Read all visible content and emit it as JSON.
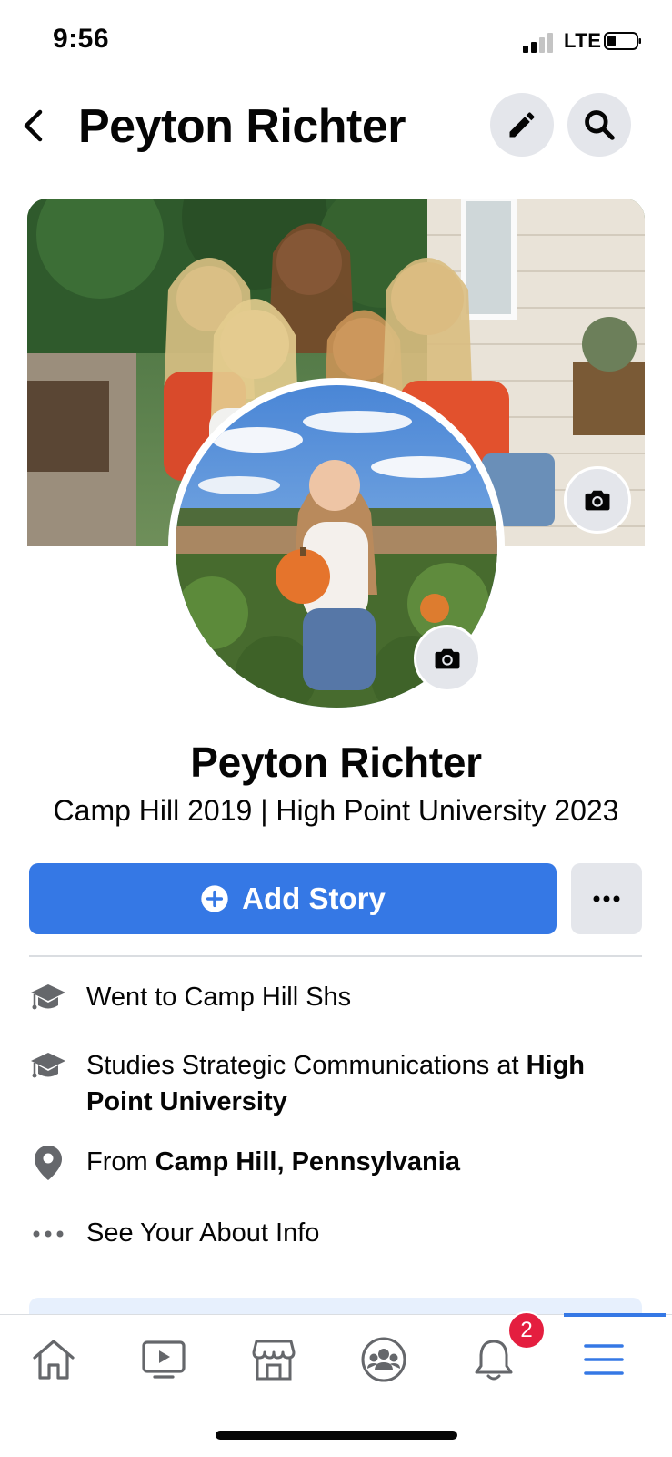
{
  "status": {
    "time": "9:56",
    "network": "LTE"
  },
  "header": {
    "title": "Peyton Richter"
  },
  "profile": {
    "name": "Peyton Richter",
    "bio": "Camp Hill 2019 | High Point University 2023",
    "add_story_label": "Add Story"
  },
  "about": [
    {
      "icon": "graduation-cap-icon",
      "text": "Went to Camp Hill Shs"
    },
    {
      "icon": "graduation-cap-icon",
      "prefix": "Studies Strategic Communications at ",
      "bold": "High Point University"
    },
    {
      "icon": "location-pin-icon",
      "prefix": "From ",
      "bold": "Camp Hill, Pennsylvania"
    },
    {
      "icon": "more-dots-icon",
      "text": "See Your About Info"
    }
  ],
  "tabs": [
    {
      "name": "home",
      "icon": "home-icon"
    },
    {
      "name": "watch",
      "icon": "video-icon"
    },
    {
      "name": "marketplace",
      "icon": "store-icon"
    },
    {
      "name": "groups",
      "icon": "groups-icon"
    },
    {
      "name": "notifications",
      "icon": "bell-icon",
      "badge": "2"
    },
    {
      "name": "menu",
      "icon": "menu-icon",
      "active": true
    }
  ],
  "colors": {
    "accent": "#3578e5",
    "badge": "#e41e3f",
    "button_gray": "#e4e6eb"
  }
}
